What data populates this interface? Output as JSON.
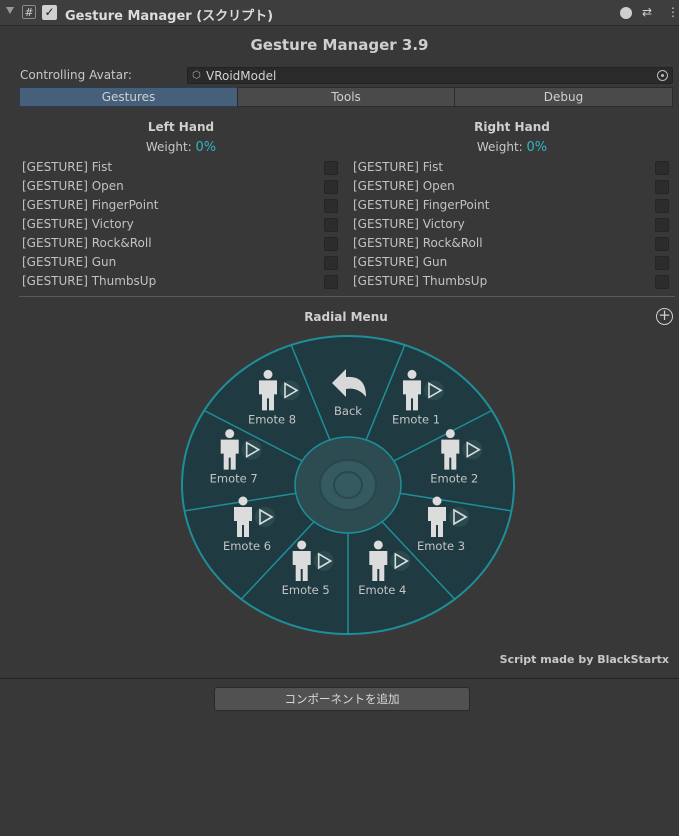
{
  "header": {
    "title": "Gesture Manager (スクリプト)",
    "script_glyph": "#",
    "enabled_glyph": "✓",
    "icons": [
      "help-icon",
      "presets-icon",
      "more-icon"
    ]
  },
  "main_title": "Gesture Manager 3.9",
  "controlling": {
    "label": "Controlling Avatar:",
    "value": "VRoidModel"
  },
  "tabs": [
    {
      "label": "Gestures",
      "active": true
    },
    {
      "label": "Tools",
      "active": false
    },
    {
      "label": "Debug",
      "active": false
    }
  ],
  "left_hand": {
    "title": "Left Hand",
    "weight_label": "Weight:",
    "weight_value": "0%",
    "gestures": [
      "[GESTURE] Fist",
      "[GESTURE] Open",
      "[GESTURE] FingerPoint",
      "[GESTURE] Victory",
      "[GESTURE] Rock&Roll",
      "[GESTURE] Gun",
      "[GESTURE] ThumbsUp"
    ]
  },
  "right_hand": {
    "title": "Right Hand",
    "weight_label": "Weight:",
    "weight_value": "0%",
    "gestures": [
      "[GESTURE] Fist",
      "[GESTURE] Open",
      "[GESTURE] FingerPoint",
      "[GESTURE] Victory",
      "[GESTURE] Rock&Roll",
      "[GESTURE] Gun",
      "[GESTURE] ThumbsUp"
    ]
  },
  "radial": {
    "title": "Radial Menu",
    "back_label": "Back",
    "items": [
      "Emote 1",
      "Emote 2",
      "Emote 3",
      "Emote 4",
      "Emote 5",
      "Emote 6",
      "Emote 7",
      "Emote 8"
    ]
  },
  "credit": "Script made by BlackStartx",
  "add_component": "コンポーネントを追加",
  "colors": {
    "accent": "#2fb6c4",
    "tab_active": "#46607c",
    "wheel_fill": "#1f3a40",
    "wheel_line": "#1e8f99"
  }
}
